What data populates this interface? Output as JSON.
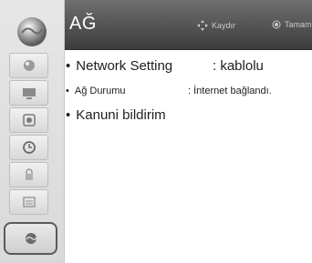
{
  "header": {
    "title": "AĞ",
    "hint_scroll": "Kaydır",
    "hint_ok": "Tamam"
  },
  "sidebar": {
    "items": [
      {
        "icon": "picture-icon"
      },
      {
        "icon": "screen-icon"
      },
      {
        "icon": "audio-icon"
      },
      {
        "icon": "clock-icon"
      },
      {
        "icon": "lock-icon"
      },
      {
        "icon": "options-icon"
      },
      {
        "icon": "network-icon",
        "selected": true
      }
    ]
  },
  "main": {
    "rows": [
      {
        "label": "Network Setting",
        "value": ": kablolu"
      },
      {
        "label": "Ağ Durumu",
        "value": ": İnternet bağlandı."
      },
      {
        "label": "Kanuni bildirim",
        "value": ""
      }
    ]
  }
}
